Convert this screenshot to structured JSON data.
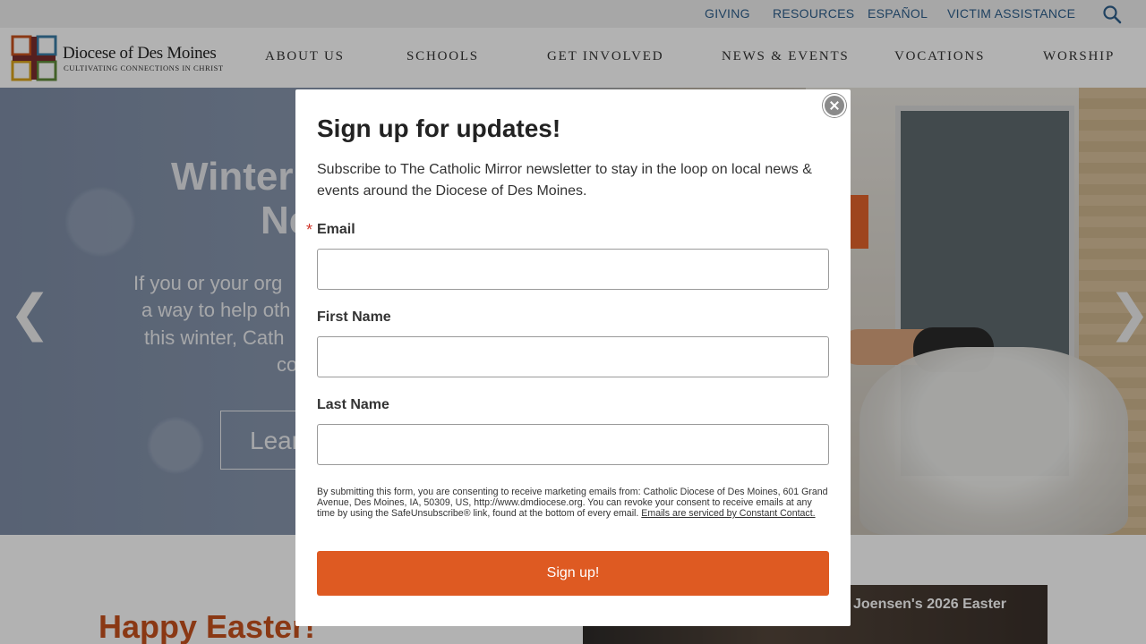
{
  "utility_nav": {
    "items": [
      "GIVING",
      "RESOURCES",
      "ESPAÑOL",
      "VICTIM ASSISTANCE"
    ],
    "search_icon": "search-icon"
  },
  "header": {
    "logo_title": "Diocese of Des Moines",
    "logo_tagline": "CULTIVATING CONNECTIONS IN CHRIST",
    "nav": [
      "ABOUT US",
      "SCHOOLS",
      "GET INVOLVED",
      "NEWS & EVENTS",
      "VOCATIONS",
      "WORSHIP"
    ]
  },
  "hero": {
    "headline_line1": "Winter",
    "headline_line2": "Ne",
    "body_lines": [
      "If you or your org",
      "a way to help oth",
      "this winter, Cath",
      "co"
    ],
    "cta_label": "Lear",
    "prev_arrow": "❮",
    "next_arrow": "❯"
  },
  "below": {
    "section_title": "Happy Easter!",
    "video_title": "Joensen's 2026 Easter"
  },
  "modal": {
    "title": "Sign up for updates!",
    "description": "Subscribe to The Catholic Mirror newsletter to stay in the loop on local news & events around the Diocese of Des Moines.",
    "required_marker": "*",
    "email_label": "Email",
    "email_value": "",
    "first_name_label": "First Name",
    "first_name_value": "",
    "last_name_label": "Last Name",
    "last_name_value": "",
    "consent_text": "By submitting this form, you are consenting to receive marketing emails from: Catholic Diocese of Des Moines, 601 Grand Avenue, Des Moines, IA, 50309, US, http://www.dmdiocese.org. You can revoke your consent to receive emails at any time by using the SafeUnsubscribe® link, found at the bottom of every email. ",
    "consent_link": "Emails are serviced by Constant Contact.",
    "submit_label": "Sign up!",
    "close_icon": "close-icon"
  },
  "colors": {
    "accent_orange": "#de5a22",
    "title_orange": "#c6511d",
    "utility_link": "#2e5f8c"
  }
}
